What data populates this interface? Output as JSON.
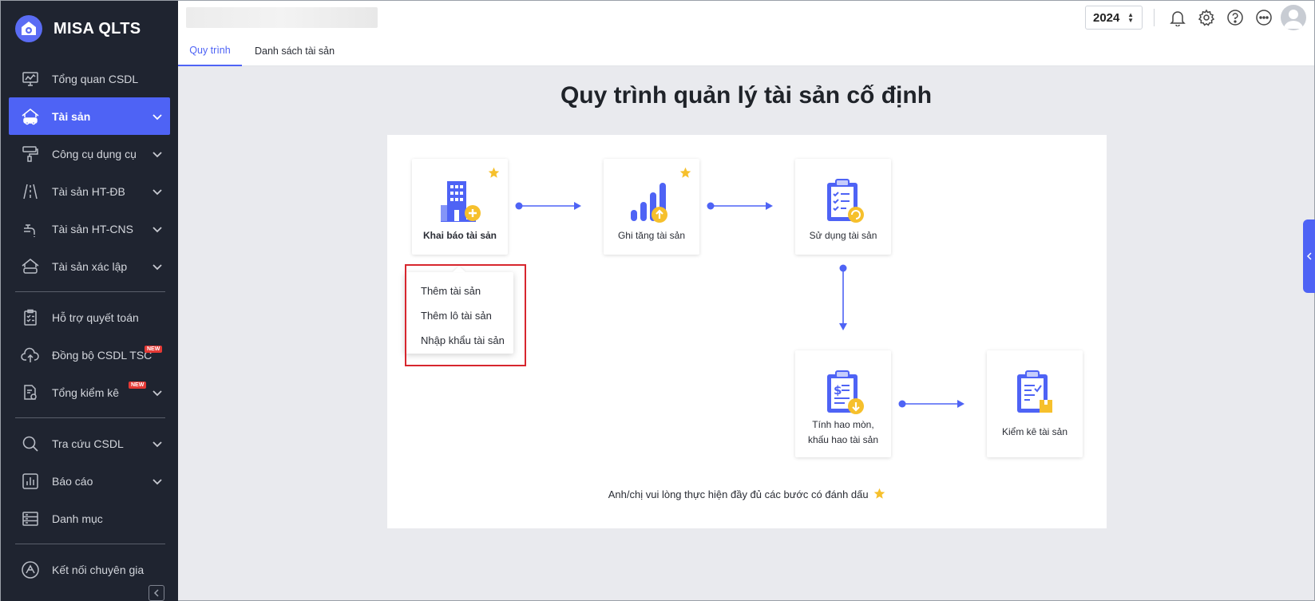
{
  "app": {
    "name": "MISA QLTS"
  },
  "sidebar": {
    "items": [
      {
        "label": "Tổng quan CSDL",
        "icon": "monitor-chart-icon"
      },
      {
        "label": "Tài sản",
        "icon": "house-car-icon",
        "active": true
      },
      {
        "label": "Công cụ dụng cụ",
        "icon": "paint-roller-icon"
      },
      {
        "label": "Tài sản HT-ĐB",
        "icon": "road-icon"
      },
      {
        "label": "Tài sản HT-CNS",
        "icon": "water-tap-icon"
      },
      {
        "label": "Tài sản xác lập",
        "icon": "house-car-outline-icon"
      },
      {
        "label": "Hỗ trợ quyết toán",
        "icon": "clipboard-check-icon"
      },
      {
        "label": "Đồng bộ CSDL TSC",
        "icon": "cloud-upload-icon",
        "badge": "NEW"
      },
      {
        "label": "Tổng kiểm kê",
        "icon": "document-search-icon",
        "badge": "NEW"
      },
      {
        "label": "Tra cứu CSDL",
        "icon": "magnifier-icon"
      },
      {
        "label": "Báo cáo",
        "icon": "bar-chart-icon"
      },
      {
        "label": "Danh mục",
        "icon": "server-list-icon"
      },
      {
        "label": "Kết nối chuyên gia",
        "icon": "expert-connect-icon"
      }
    ]
  },
  "header": {
    "tabs": [
      "Quy trình",
      "Danh sách tài sản"
    ],
    "year": "2024"
  },
  "main": {
    "title": "Quy trình quản lý tài sản cố định",
    "steps": [
      {
        "label": "Khai báo tài sản",
        "icon": "building-add-icon",
        "starred": true
      },
      {
        "label": "Ghi tăng tài sản",
        "icon": "signal-up-icon",
        "starred": true
      },
      {
        "label": "Sử dụng tài sản",
        "icon": "clipboard-refresh-icon",
        "starred": false
      },
      {
        "label_line1": "Tính hao mòn,",
        "label_line2": "khấu hao tài sản",
        "icon": "clipboard-dollar-icon",
        "starred": false
      },
      {
        "label": "Kiểm kê tài sản",
        "icon": "clipboard-box-icon",
        "starred": false
      }
    ],
    "dropdown": [
      "Thêm tài sản",
      "Thêm lô tài sản",
      "Nhập khẩu tài sản"
    ],
    "hint": "Anh/chị vui lòng thực hiện đầy đủ các bước có đánh dấu"
  },
  "colors": {
    "accent": "#4e63f5",
    "sidebar_bg": "#1f2430",
    "star": "#f6c02c",
    "highlight_frame": "#d7262e"
  }
}
